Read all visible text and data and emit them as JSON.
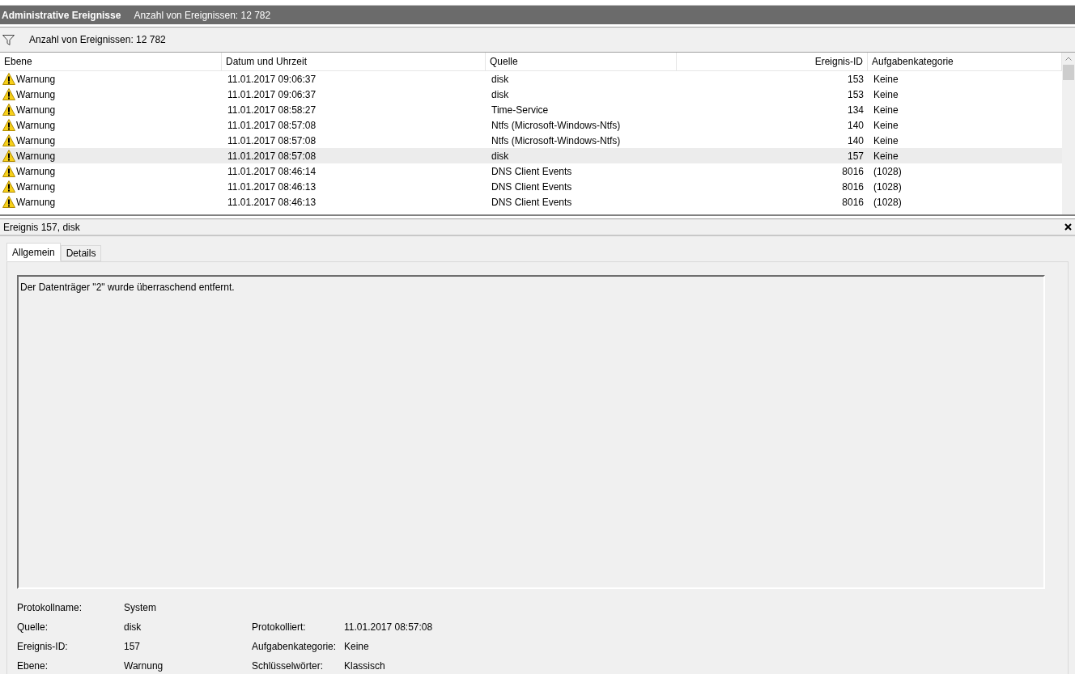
{
  "title_bar": {
    "title": "Administrative Ereignisse",
    "count": "Anzahl von Ereignissen: 12 782"
  },
  "filter_bar": {
    "text": "Anzahl von Ereignissen: 12 782"
  },
  "table": {
    "columns": [
      "Ebene",
      "Datum und Uhrzeit",
      "Quelle",
      "Ereignis-ID",
      "Aufgabenkategorie"
    ],
    "rows": [
      {
        "level": "Warnung",
        "date": "11.01.2017 09:06:37",
        "source": "disk",
        "id": "153",
        "category": "Keine",
        "selected": false
      },
      {
        "level": "Warnung",
        "date": "11.01.2017 09:06:37",
        "source": "disk",
        "id": "153",
        "category": "Keine",
        "selected": false
      },
      {
        "level": "Warnung",
        "date": "11.01.2017 08:58:27",
        "source": "Time-Service",
        "id": "134",
        "category": "Keine",
        "selected": false
      },
      {
        "level": "Warnung",
        "date": "11.01.2017 08:57:08",
        "source": "Ntfs (Microsoft-Windows-Ntfs)",
        "id": "140",
        "category": "Keine",
        "selected": false
      },
      {
        "level": "Warnung",
        "date": "11.01.2017 08:57:08",
        "source": "Ntfs (Microsoft-Windows-Ntfs)",
        "id": "140",
        "category": "Keine",
        "selected": false
      },
      {
        "level": "Warnung",
        "date": "11.01.2017 08:57:08",
        "source": "disk",
        "id": "157",
        "category": "Keine",
        "selected": true
      },
      {
        "level": "Warnung",
        "date": "11.01.2017 08:46:14",
        "source": "DNS Client Events",
        "id": "8016",
        "category": "(1028)",
        "selected": false
      },
      {
        "level": "Warnung",
        "date": "11.01.2017 08:46:13",
        "source": "DNS Client Events",
        "id": "8016",
        "category": "(1028)",
        "selected": false
      },
      {
        "level": "Warnung",
        "date": "11.01.2017 08:46:13",
        "source": "DNS Client Events",
        "id": "8016",
        "category": "(1028)",
        "selected": false
      }
    ]
  },
  "detail": {
    "title": "Ereignis 157, disk",
    "tabs": [
      {
        "label": "Allgemein",
        "selected": true
      },
      {
        "label": "Details",
        "selected": false
      }
    ],
    "message": "Der Datenträger \"2\" wurde überraschend entfernt.",
    "properties": [
      {
        "label": "Protokollname:",
        "value": "System"
      },
      {
        "label": "Quelle:",
        "value": "disk",
        "label_2": "Protokolliert:",
        "value_2": "11.01.2017 08:57:08"
      },
      {
        "label": "Ereignis-ID:",
        "value": "157",
        "label_2": "Aufgabenkategorie:",
        "value_2": "Keine"
      },
      {
        "label": "Ebene:",
        "value": "Warnung",
        "label_2": "Schlüsselwörter:",
        "value_2": "Klassisch"
      }
    ]
  }
}
